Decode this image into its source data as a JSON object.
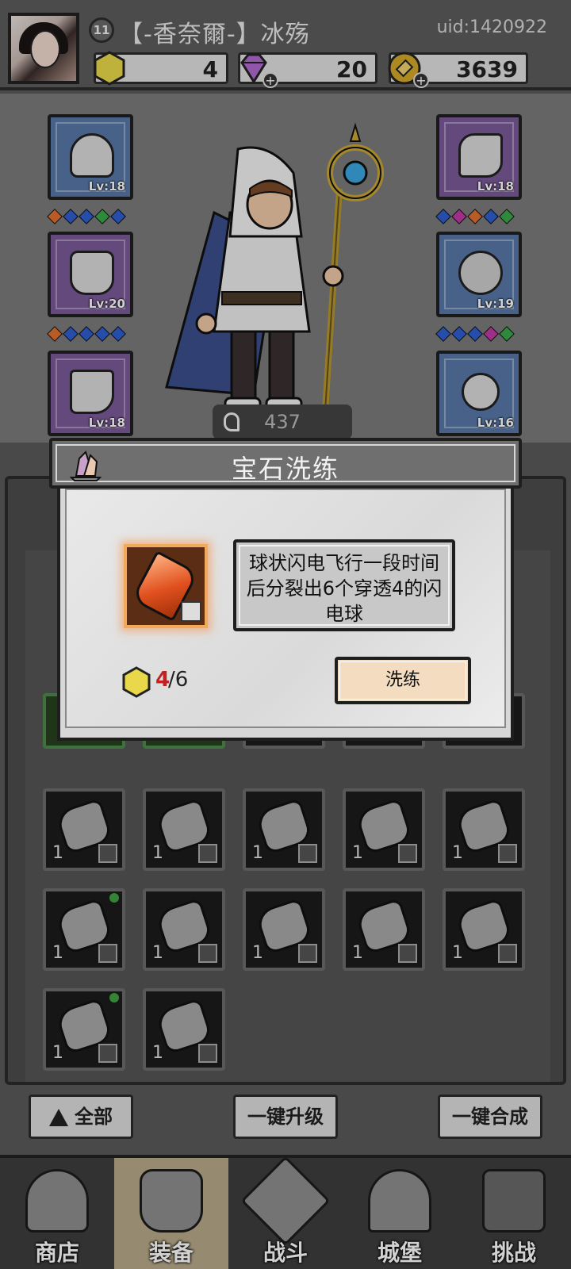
{
  "player": {
    "level": "11",
    "name": "【-香奈爾-】冰殇",
    "uid": "uid:1420922"
  },
  "resources": [
    {
      "name": "energy",
      "icon": "yellow-hex-coin-icon",
      "value": "4",
      "color": "#e8d84a"
    },
    {
      "name": "gems",
      "icon": "purple-diamond-icon",
      "value": "20",
      "color": "#a05ab8"
    },
    {
      "name": "gold",
      "icon": "gold-coin-icon",
      "value": "3639",
      "color": "#d4a82a"
    }
  ],
  "equipment": {
    "left": [
      {
        "slot": "helmet",
        "level": "Lv:18",
        "rarity": "blue",
        "icon": "hood-icon"
      },
      {
        "slot": "armor",
        "level": "Lv:20",
        "rarity": "purple",
        "icon": "cloak-icon"
      },
      {
        "slot": "boots",
        "level": "Lv:18",
        "rarity": "purple",
        "icon": "boot-icon"
      }
    ],
    "right": [
      {
        "slot": "bracer",
        "level": "Lv:18",
        "rarity": "purple",
        "icon": "bracer-icon"
      },
      {
        "slot": "ring",
        "level": "Lv:19",
        "rarity": "blue",
        "icon": "ring-icon"
      },
      {
        "slot": "necklace",
        "level": "Lv:16",
        "rarity": "blue",
        "icon": "necklace-icon"
      }
    ],
    "gem_rows": [
      [
        "#e07030",
        "#2f5fd0",
        "#2f5fd0",
        "#3aa84a",
        "#2f5fd0"
      ],
      [
        "#2f5fd0",
        "#c03aa8",
        "#e07030",
        "#2f5fd0",
        "#3aa84a"
      ],
      [
        "#e07030",
        "#2f5fd0",
        "#2f5fd0",
        "#2f5fd0",
        "#2f5fd0"
      ],
      [
        "#2f5fd0",
        "#2f5fd0",
        "#2f5fd0",
        "#c03aa8",
        "#3aa84a"
      ]
    ],
    "power": "437"
  },
  "inventory": {
    "rows": [
      [
        {
          "count": "1",
          "dot": false
        },
        {
          "count": "1",
          "dot": false
        },
        {
          "count": "1",
          "dot": false
        },
        {
          "count": "1",
          "dot": false
        },
        {
          "count": "1",
          "dot": false
        }
      ],
      [
        {
          "count": "1",
          "dot": true
        },
        {
          "count": "1",
          "dot": false
        },
        {
          "count": "1",
          "dot": false
        },
        {
          "count": "1",
          "dot": false
        },
        {
          "count": "1",
          "dot": false
        }
      ],
      [
        {
          "count": "1",
          "dot": true
        },
        {
          "count": "1",
          "dot": false
        }
      ]
    ]
  },
  "actions": {
    "all": "全部",
    "upgrade_all": "一键升级",
    "merge_all": "一键合成"
  },
  "nav": [
    {
      "label": "商店",
      "icon": "shop-icon",
      "active": false
    },
    {
      "label": "装备",
      "icon": "backpack-icon",
      "active": true
    },
    {
      "label": "战斗",
      "icon": "crossed-swords-icon",
      "active": false
    },
    {
      "label": "城堡",
      "icon": "castle-icon",
      "active": false
    },
    {
      "label": "挑战",
      "icon": "challenge-lock-icon",
      "active": false
    }
  ],
  "dialog": {
    "title": "宝石洗练",
    "gem_icon": "orange-crystal-icon",
    "description": "球状闪电飞行一段时间后分裂出6个穿透4的闪电球",
    "cost_have": "4",
    "cost_need": "/6",
    "refine_label": "洗练"
  }
}
